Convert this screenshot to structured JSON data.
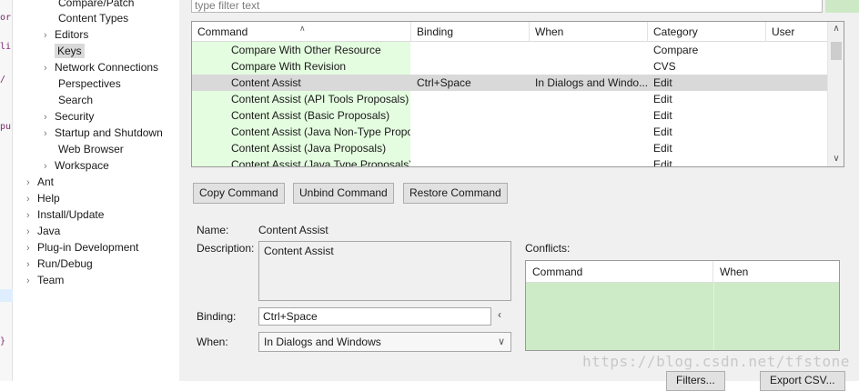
{
  "editor_fragments": [
    "or",
    "li",
    "/",
    "pu",
    "}"
  ],
  "tree": {
    "items": [
      {
        "label": "Compare/Patch",
        "chevron": false
      },
      {
        "label": "Content Types",
        "chevron": false
      },
      {
        "label": "Editors",
        "chevron": true
      },
      {
        "label": "Keys",
        "chevron": false,
        "selected": true
      },
      {
        "label": "Network Connections",
        "chevron": true
      },
      {
        "label": "Perspectives",
        "chevron": false
      },
      {
        "label": "Search",
        "chevron": false
      },
      {
        "label": "Security",
        "chevron": true
      },
      {
        "label": "Startup and Shutdown",
        "chevron": true
      },
      {
        "label": "Web Browser",
        "chevron": false
      },
      {
        "label": "Workspace",
        "chevron": true
      },
      {
        "label": "Ant",
        "chevron": true
      },
      {
        "label": "Help",
        "chevron": true
      },
      {
        "label": "Install/Update",
        "chevron": true
      },
      {
        "label": "Java",
        "chevron": true
      },
      {
        "label": "Plug-in Development",
        "chevron": true
      },
      {
        "label": "Run/Debug",
        "chevron": true
      },
      {
        "label": "Team",
        "chevron": true
      }
    ]
  },
  "filter": {
    "placeholder": "type filter text"
  },
  "grid": {
    "headers": [
      "Command",
      "Binding",
      "When",
      "Category",
      "User"
    ],
    "rows": [
      {
        "command": "Compare With Other Resource",
        "binding": "",
        "when": "",
        "category": "Compare",
        "user": ""
      },
      {
        "command": "Compare With Revision",
        "binding": "",
        "when": "",
        "category": "CVS",
        "user": ""
      },
      {
        "command": "Content Assist",
        "binding": "Ctrl+Space",
        "when": "In Dialogs and Windo...",
        "category": "Edit",
        "user": "",
        "selected": true
      },
      {
        "command": "Content Assist (API Tools Proposals)",
        "binding": "",
        "when": "",
        "category": "Edit",
        "user": ""
      },
      {
        "command": "Content Assist (Basic Proposals)",
        "binding": "",
        "when": "",
        "category": "Edit",
        "user": ""
      },
      {
        "command": "Content Assist (Java Non-Type Propo",
        "binding": "",
        "when": "",
        "category": "Edit",
        "user": ""
      },
      {
        "command": "Content Assist (Java Proposals)",
        "binding": "",
        "when": "",
        "category": "Edit",
        "user": ""
      },
      {
        "command": "Content Assist (Java Type Proposals)",
        "binding": "",
        "when": "",
        "category": "Edit",
        "user": ""
      }
    ]
  },
  "buttons": {
    "copy": "Copy Command",
    "unbind": "Unbind Command",
    "restore": "Restore Command",
    "filters": "Filters...",
    "export": "Export CSV..."
  },
  "details": {
    "name_label": "Name:",
    "name_value": "Content Assist",
    "description_label": "Description:",
    "description_value": "Content Assist",
    "binding_label": "Binding:",
    "binding_value": "Ctrl+Space",
    "when_label": "When:",
    "when_value": "In Dialogs and Windows"
  },
  "conflicts": {
    "label": "Conflicts:",
    "headers": [
      "Command",
      "When"
    ]
  },
  "watermark": "https://blog.csdn.net/tfstone",
  "colors": {
    "command_cell": "#e4fce0",
    "selection": "#d9d9d9",
    "conflicts_bg": "#cdebc6"
  }
}
